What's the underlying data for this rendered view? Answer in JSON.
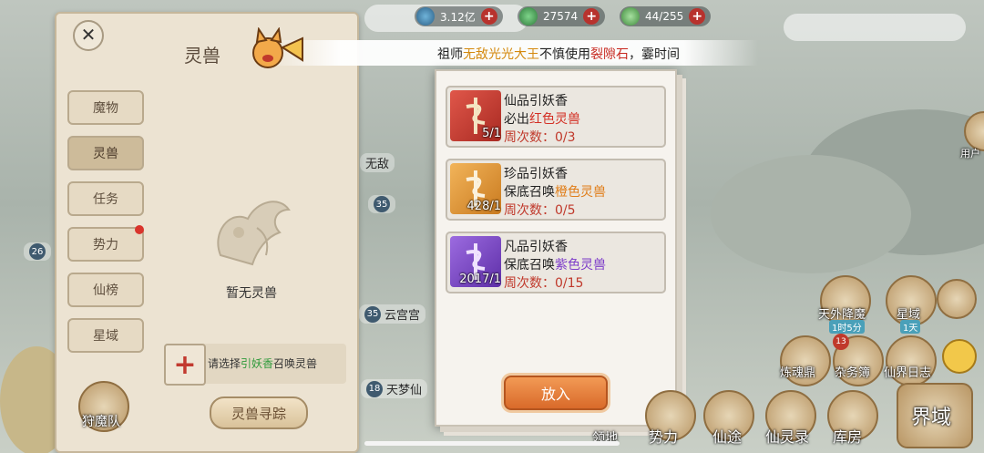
{
  "resources": [
    {
      "value": "3.12亿",
      "icon": "spirit-stone-icon"
    },
    {
      "value": "27574",
      "icon": "jade-icon"
    },
    {
      "value": "44/255",
      "icon": "stamina-icon"
    }
  ],
  "panel": {
    "title": "灵兽",
    "tabs": [
      "魔物",
      "灵兽",
      "任务",
      "势力",
      "仙榜",
      "星域"
    ],
    "empty_text": "暂无灵兽",
    "hint_prefix": "请选择",
    "hint_highlight": "引妖香",
    "hint_suffix": "召唤灵兽",
    "track_button": "灵兽寻踪"
  },
  "ticker": {
    "prefix": "祖师",
    "player": "无敌光光大王",
    "mid": "不慎使用",
    "item": "裂隙石",
    "suffix": "，霎时间"
  },
  "modal": {
    "items": [
      {
        "name": "仙品引妖香",
        "desc_prefix": "必出",
        "desc_highlight": "红色灵兽",
        "count": "5/1",
        "weekly": "周次数：0/3",
        "color": "#d32f24"
      },
      {
        "name": "珍品引妖香",
        "desc_prefix": "保底召唤",
        "desc_highlight": "橙色灵兽",
        "count": "428/1",
        "weekly": "周次数：0/5",
        "color": "#e07e1a"
      },
      {
        "name": "凡品引妖香",
        "desc_prefix": "保底召唤",
        "desc_highlight": "紫色灵兽",
        "count": "2017/1",
        "weekly": "周次数：0/15",
        "color": "#7d3cc9"
      }
    ],
    "put_button": "放入"
  },
  "map_labels": [
    "无敌",
    "天梦仙",
    "云宫宫"
  ],
  "map_levels": [
    "26",
    "35",
    "35",
    "18"
  ],
  "right_menu": {
    "user_label": "用户",
    "tianwai": {
      "label": "天外降魔",
      "sub": "1时5分"
    },
    "xingyu": {
      "label": "星域",
      "sub": "1天"
    },
    "lianhun": "炼魂鼎",
    "zawu": "杂务簿",
    "zawu_badge": "13",
    "xianjie": "仙界日志",
    "shili": "势力",
    "xiantu": "仙途",
    "xianlinglu": "仙灵录",
    "kufang": "库房",
    "jieyu": "界域",
    "lingdi": "领地"
  },
  "left_bottom": {
    "hunt_team": "狩魔队"
  }
}
